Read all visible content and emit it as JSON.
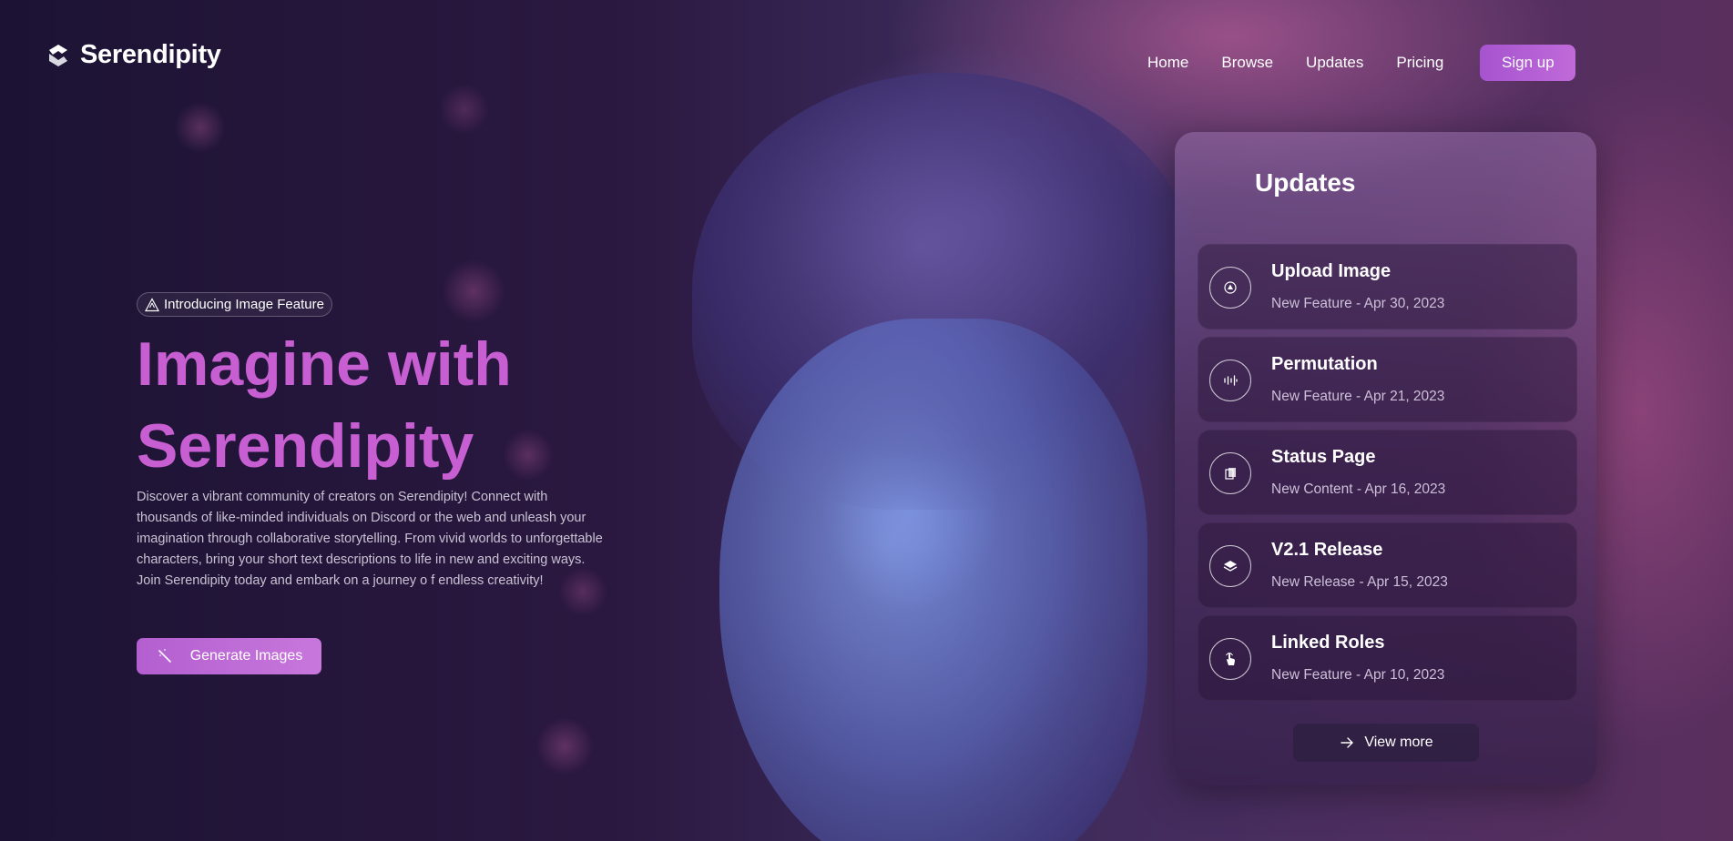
{
  "brand": {
    "name": "Serendipity",
    "logo_icon": "serendipity-logo-icon"
  },
  "nav": {
    "links": [
      "Home",
      "Browse",
      "Updates",
      "Pricing"
    ],
    "signup_label": "Sign up"
  },
  "hero": {
    "badge_icon": "warning-triangle-icon",
    "badge_label": "Introducing Image Feature",
    "title_line1": "Imagine with",
    "title_line2": "Serendipity",
    "description": "Discover a vibrant community of creators on Serendipity! Connect with thousands of like-minded individuals on Discord or the web and unleash your imagination through collaborative storytelling. From vivid worlds to unforgettable characters, bring your short text descriptions to life in new and exciting ways. Join Serendipity today and embark on a journey o f endless creativity!",
    "cta_label": "Generate Images",
    "cta_icon": "magic-wand-icon"
  },
  "updates": {
    "title": "Updates",
    "items": [
      {
        "title": "Upload Image",
        "subtitle": "New Feature - Apr 30, 2023",
        "icon": "upload-icon"
      },
      {
        "title": "Permutation",
        "subtitle": "New Feature - Apr 21, 2023",
        "icon": "waveform-icon"
      },
      {
        "title": "Status Page",
        "subtitle": "New Content - Apr 16, 2023",
        "icon": "pages-icon"
      },
      {
        "title": "V2.1 Release",
        "subtitle": "New Release - Apr 15, 2023",
        "icon": "layers-icon"
      },
      {
        "title": "Linked Roles",
        "subtitle": "New Feature - Apr 10, 2023",
        "icon": "tap-hand-icon"
      }
    ],
    "view_more_label": "View more",
    "view_more_icon": "arrow-right-icon"
  },
  "colors": {
    "accent": "#c75fd2",
    "button": "#b35fd0",
    "background": "#1c1334"
  }
}
